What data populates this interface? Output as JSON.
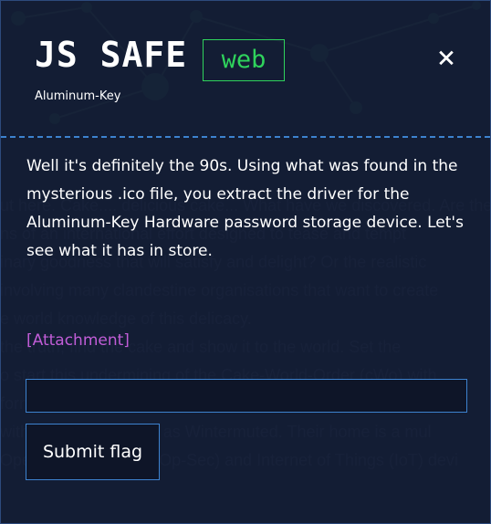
{
  "modal": {
    "title": "JS SAFE",
    "category": "web",
    "subtitle": "Aluminum-Key",
    "close_icon": "close-icon",
    "description": "Well it's definitely the 90s. Using what was found in the mysterious .ico file, you extract the driver for the Aluminum-Key Hardware password storage device. Let's see what it has in store.",
    "attachment_label": "[Attachment]",
    "flag_input": {
      "value": "",
      "placeholder": ""
    },
    "submit_label": "Submit flag"
  },
  "background_text": [
    "ut here. Cake.... delicious cake... What have we discovered. Are the",
    "ns of an international effort designed to tease and tempt",
    "inary goodness that will satisfy and delight? Or the realistic",
    "involving many clandestine organisations that want to create",
    "e world knowledge of this delicacy.",
    "",
    "the truth, find the cake and show it to the world. Set the",
    "o start this undermining of the Cake-World-Order (cWo) with",
    "formants deep in the field (some no longer with us), have",
    "within the cWo known as Wintermuted. Their home is a mul",
    "Operational Security (Op-Sec) and Internet of Things (IoT) devi"
  ],
  "colors": {
    "accent_green": "#2fd35c",
    "accent_blue": "#3d82cf",
    "attachment_purple": "#c15dd7",
    "background": "#131c34"
  }
}
